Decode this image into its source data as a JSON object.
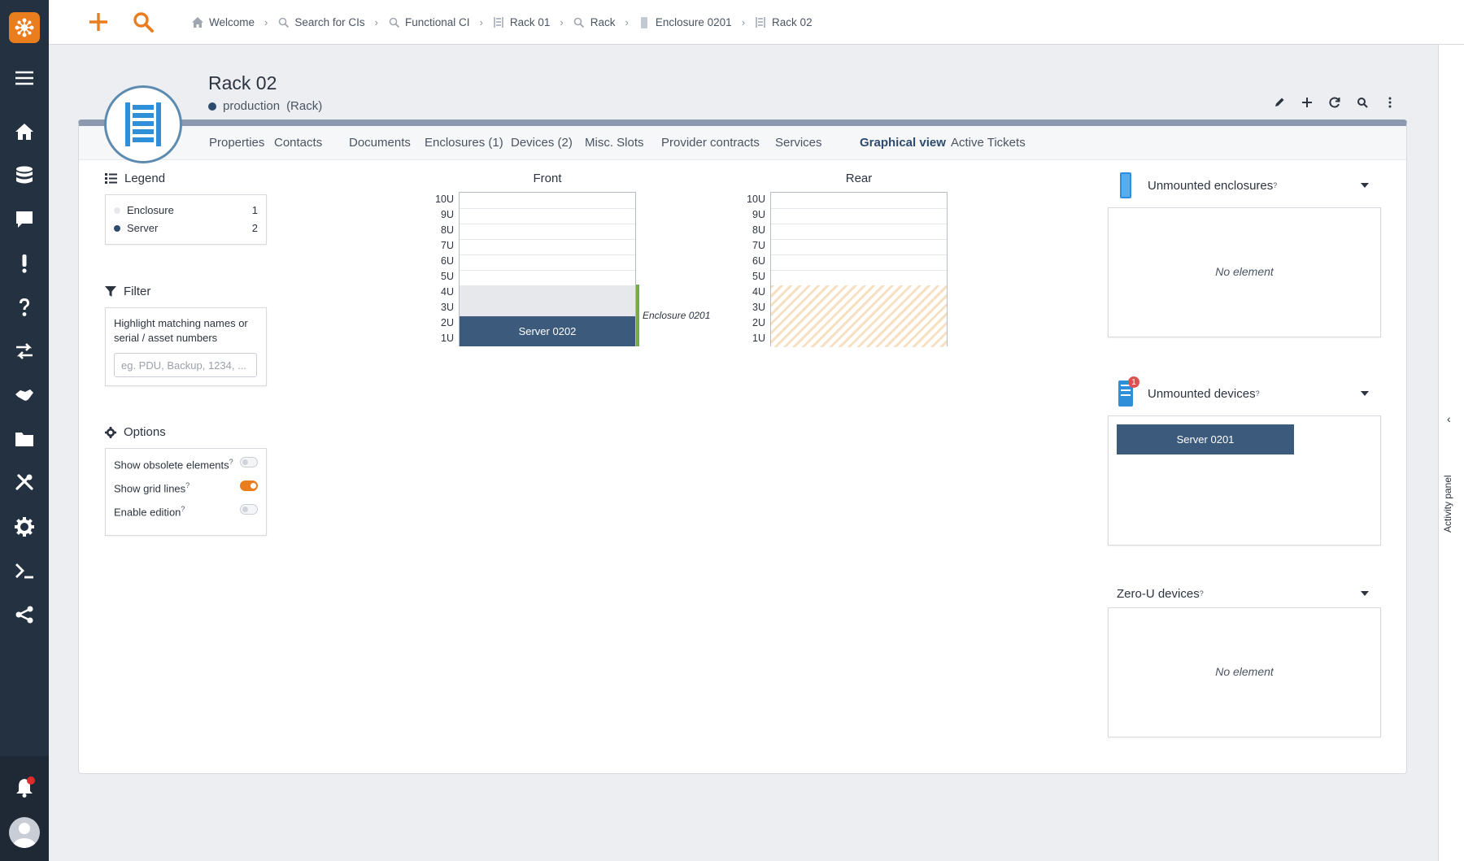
{
  "sidebar": {
    "items": [
      {
        "icon": "menu-icon"
      },
      {
        "icon": "home-icon"
      },
      {
        "icon": "database-icon"
      },
      {
        "icon": "chat-icon"
      },
      {
        "icon": "exclamation-icon"
      },
      {
        "icon": "question-icon"
      },
      {
        "icon": "exchange-icon"
      },
      {
        "icon": "handshake-icon"
      },
      {
        "icon": "folder-icon"
      },
      {
        "icon": "tools-icon"
      },
      {
        "icon": "gear-icon"
      },
      {
        "icon": "terminal-icon"
      },
      {
        "icon": "share-icon"
      }
    ],
    "bottom": [
      {
        "icon": "bell-icon"
      },
      {
        "icon": "avatar"
      }
    ]
  },
  "topbar": {
    "breadcrumbs": [
      {
        "label": "Welcome",
        "icon": "home-icon"
      },
      {
        "label": "Search for CIs",
        "icon": "search-icon"
      },
      {
        "label": "Functional CI",
        "icon": "search-icon"
      },
      {
        "label": "Rack 01",
        "icon": "rack-icon"
      },
      {
        "label": "Rack",
        "icon": "search-icon"
      },
      {
        "label": "Enclosure 0201",
        "icon": "enclosure-icon"
      },
      {
        "label": "Rack 02",
        "icon": "rack-icon"
      }
    ]
  },
  "object": {
    "title": "Rack 02",
    "status": "production",
    "class": "(Rack)"
  },
  "tabs": [
    {
      "label": "Properties",
      "active": false
    },
    {
      "label": "Contacts",
      "active": false
    },
    {
      "label": "Documents",
      "active": false
    },
    {
      "label": "Enclosures (1)",
      "active": false
    },
    {
      "label": "Devices (2)",
      "active": false
    },
    {
      "label": "Misc. Slots",
      "active": false
    },
    {
      "label": "Provider contracts",
      "active": false
    },
    {
      "label": "Services",
      "active": false
    },
    {
      "label": "Graphical view",
      "active": true
    },
    {
      "label": "Active Tickets",
      "active": false
    }
  ],
  "legend": {
    "title": "Legend",
    "items": [
      {
        "label": "Enclosure",
        "count": "1",
        "color": "#e6e8eb"
      },
      {
        "label": "Server",
        "count": "2",
        "color": "#2e4b6d"
      }
    ]
  },
  "filter": {
    "title": "Filter",
    "help": "Highlight matching names or serial / asset numbers",
    "placeholder": "eg. PDU, Backup, 1234, ..."
  },
  "options": {
    "title": "Options",
    "items": [
      {
        "label": "Show obsolete elements",
        "sup": "?",
        "on": false
      },
      {
        "label": "Show grid lines",
        "sup": "?",
        "on": true
      },
      {
        "label": "Enable edition",
        "sup": "?",
        "on": false
      }
    ]
  },
  "racks": {
    "front_title": "Front",
    "rear_title": "Rear",
    "units": [
      "10U",
      "9U",
      "8U",
      "7U",
      "6U",
      "5U",
      "4U",
      "3U",
      "2U",
      "1U"
    ],
    "server_label": "Server 0202",
    "enclosure_label": "Enclosure 0201"
  },
  "right_panels": {
    "unmounted_enclosures": {
      "title": "Unmounted enclosures",
      "sup": "?",
      "empty": "No element"
    },
    "unmounted_devices": {
      "title": "Unmounted devices",
      "sup": "?",
      "badge": "1",
      "device": "Server 0201"
    },
    "zero_u": {
      "title": "Zero-U devices",
      "sup": "?",
      "empty": "No element"
    }
  },
  "activity_panel": {
    "label": "Activity panel"
  },
  "colors": {
    "accent": "#ea7d1e",
    "primary": "#2e4b6d",
    "sidebar": "#243140",
    "server": "#3c5a7c"
  }
}
